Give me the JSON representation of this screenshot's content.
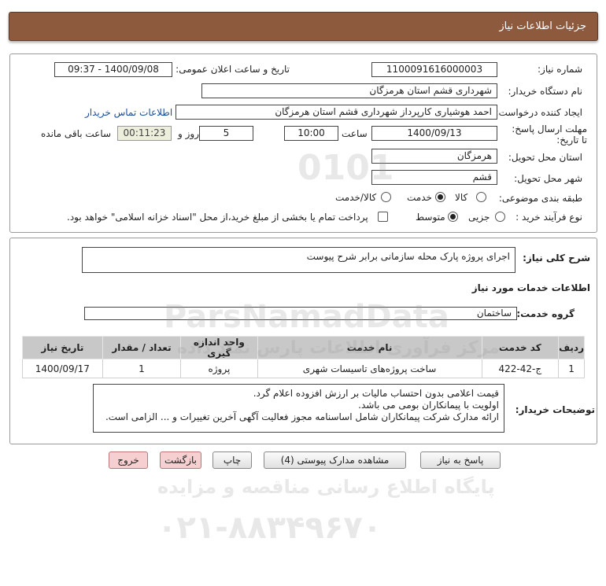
{
  "header": {
    "title": "جزئیات اطلاعات نیاز"
  },
  "form": {
    "need_number": {
      "label": "شماره نیاز:",
      "value": "1100091616000003"
    },
    "announce_datetime": {
      "label": "تاریخ و ساعت اعلان عمومی:",
      "value": "1400/09/08 - 09:37"
    },
    "buyer_org": {
      "label": "نام دستگاه خریدار:",
      "value": "شهرداری قشم استان هرمزگان"
    },
    "requester": {
      "label": "ایجاد کننده درخواست:",
      "value": "احمد هوشیاری کارپرداز شهرداری قشم استان هرمزگان",
      "contact_link": "اطلاعات تماس خریدار"
    },
    "deadline": {
      "label": "مهلت ارسال پاسخ: تا تاریخ:",
      "date": "1400/09/13",
      "time_label": "ساعت",
      "time": "10:00",
      "days": "5",
      "days_label": "روز و",
      "remaining": "00:11:23",
      "remaining_label": "ساعت باقی مانده"
    },
    "province": {
      "label": "استان محل تحویل:",
      "value": "هرمزگان"
    },
    "city": {
      "label": "شهر محل تحویل:",
      "value": "قشم"
    },
    "category": {
      "label": "طبقه بندی موضوعی:",
      "options": [
        "کالا",
        "خدمت",
        "کالا/خدمت"
      ],
      "selected": "خدمت"
    },
    "purchase_type": {
      "label": "نوع فرآیند خرید :",
      "options": [
        "جزیی",
        "متوسط"
      ],
      "selected": "متوسط",
      "checkbox_text": "پرداخت تمام یا بخشی از مبلغ خرید،از محل \"اسناد خزانه اسلامی\" خواهد بود."
    }
  },
  "summary": {
    "general_desc_label": "شرح کلی نیاز:",
    "general_desc": "اجرای پروژه پارک محله سازمانی برابر شرح پیوست",
    "services_title": "اطلاعات خدمات مورد نیاز",
    "service_group_label": "گروه خدمت:",
    "service_group": "ساختمان",
    "table": {
      "headers": [
        "ردیف",
        "کد خدمت",
        "نام خدمت",
        "واحد اندازه گیری",
        "تعداد / مقدار",
        "تاریخ نیاز"
      ],
      "rows": [
        [
          "1",
          "ج-42-422",
          "ساخت پروژه‌های تاسیسات شهری",
          "پروژه",
          "1",
          "1400/09/17"
        ]
      ]
    },
    "buyer_notes_label": "توضیحات خریدار:",
    "buyer_notes": [
      "قیمت اعلامی بدون احتساب مالیات بر ارزش افزوده اعلام گرد.",
      "اولویت با پیمانکاران بومی می باشد.",
      "ارائه مدارک شرکت پیمانکاران شامل اساسنامه مجوز فعالیت آگهی آخرین تغییرات و ... الزامی است."
    ]
  },
  "buttons": {
    "reply": "پاسخ به نیاز",
    "attachments": "مشاهده مدارک پیوستی (4)",
    "print": "چاپ",
    "back": "بازگشت",
    "exit": "خروج"
  },
  "watermark": {
    "brand": "ParsNamadData",
    "persian_1": "مرکز فرآوری اطلاعات پارس نماد داده",
    "persian_2": "پایگاه اطلاع رسانی مناقصه و مزایده",
    "phone": "۰۲۱-۸۸۳۴۹۶۷۰",
    "digits": "0101"
  }
}
